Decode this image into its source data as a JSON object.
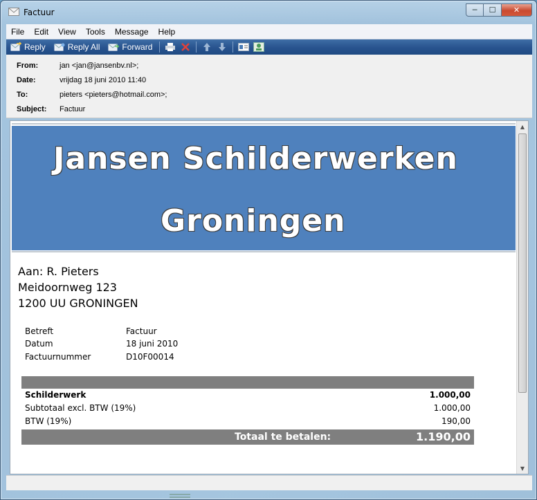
{
  "window": {
    "title": "Factuur"
  },
  "menu": [
    "File",
    "Edit",
    "View",
    "Tools",
    "Message",
    "Help"
  ],
  "toolbar": {
    "reply": "Reply",
    "reply_all": "Reply All",
    "forward": "Forward"
  },
  "header": {
    "from_label": "From:",
    "from": "jan <jan@jansenbv.nl>;",
    "date_label": "Date:",
    "date": "vrijdag 18 juni 2010 11:40",
    "to_label": "To:",
    "to": "pieters <pieters@hotmail.com>;",
    "subject_label": "Subject:",
    "subject": "Factuur"
  },
  "banner": {
    "line1": "Jansen Schilderwerken",
    "line2": "Groningen",
    "color": "#4f81bd"
  },
  "address": [
    "Aan: R. Pieters",
    "Meidoornweg 123",
    "1200 UU  GRONINGEN"
  ],
  "meta": [
    {
      "label": "Betreft",
      "value": "Factuur"
    },
    {
      "label": "Datum",
      "value": "18 juni 2010"
    },
    {
      "label": "Factuurnummer",
      "value": "D10F00014"
    }
  ],
  "invoice": {
    "lines": [
      {
        "label": "Schilderwerk",
        "amount": "1.000,00",
        "bold": true
      },
      {
        "label": "Subtotaal excl. BTW (19%)",
        "amount": "1.000,00",
        "bold": false
      },
      {
        "label": "BTW (19%)",
        "amount": "190,00",
        "bold": false
      }
    ],
    "total_label": "Totaal te betalen:",
    "total_amount": "1.190,00"
  }
}
